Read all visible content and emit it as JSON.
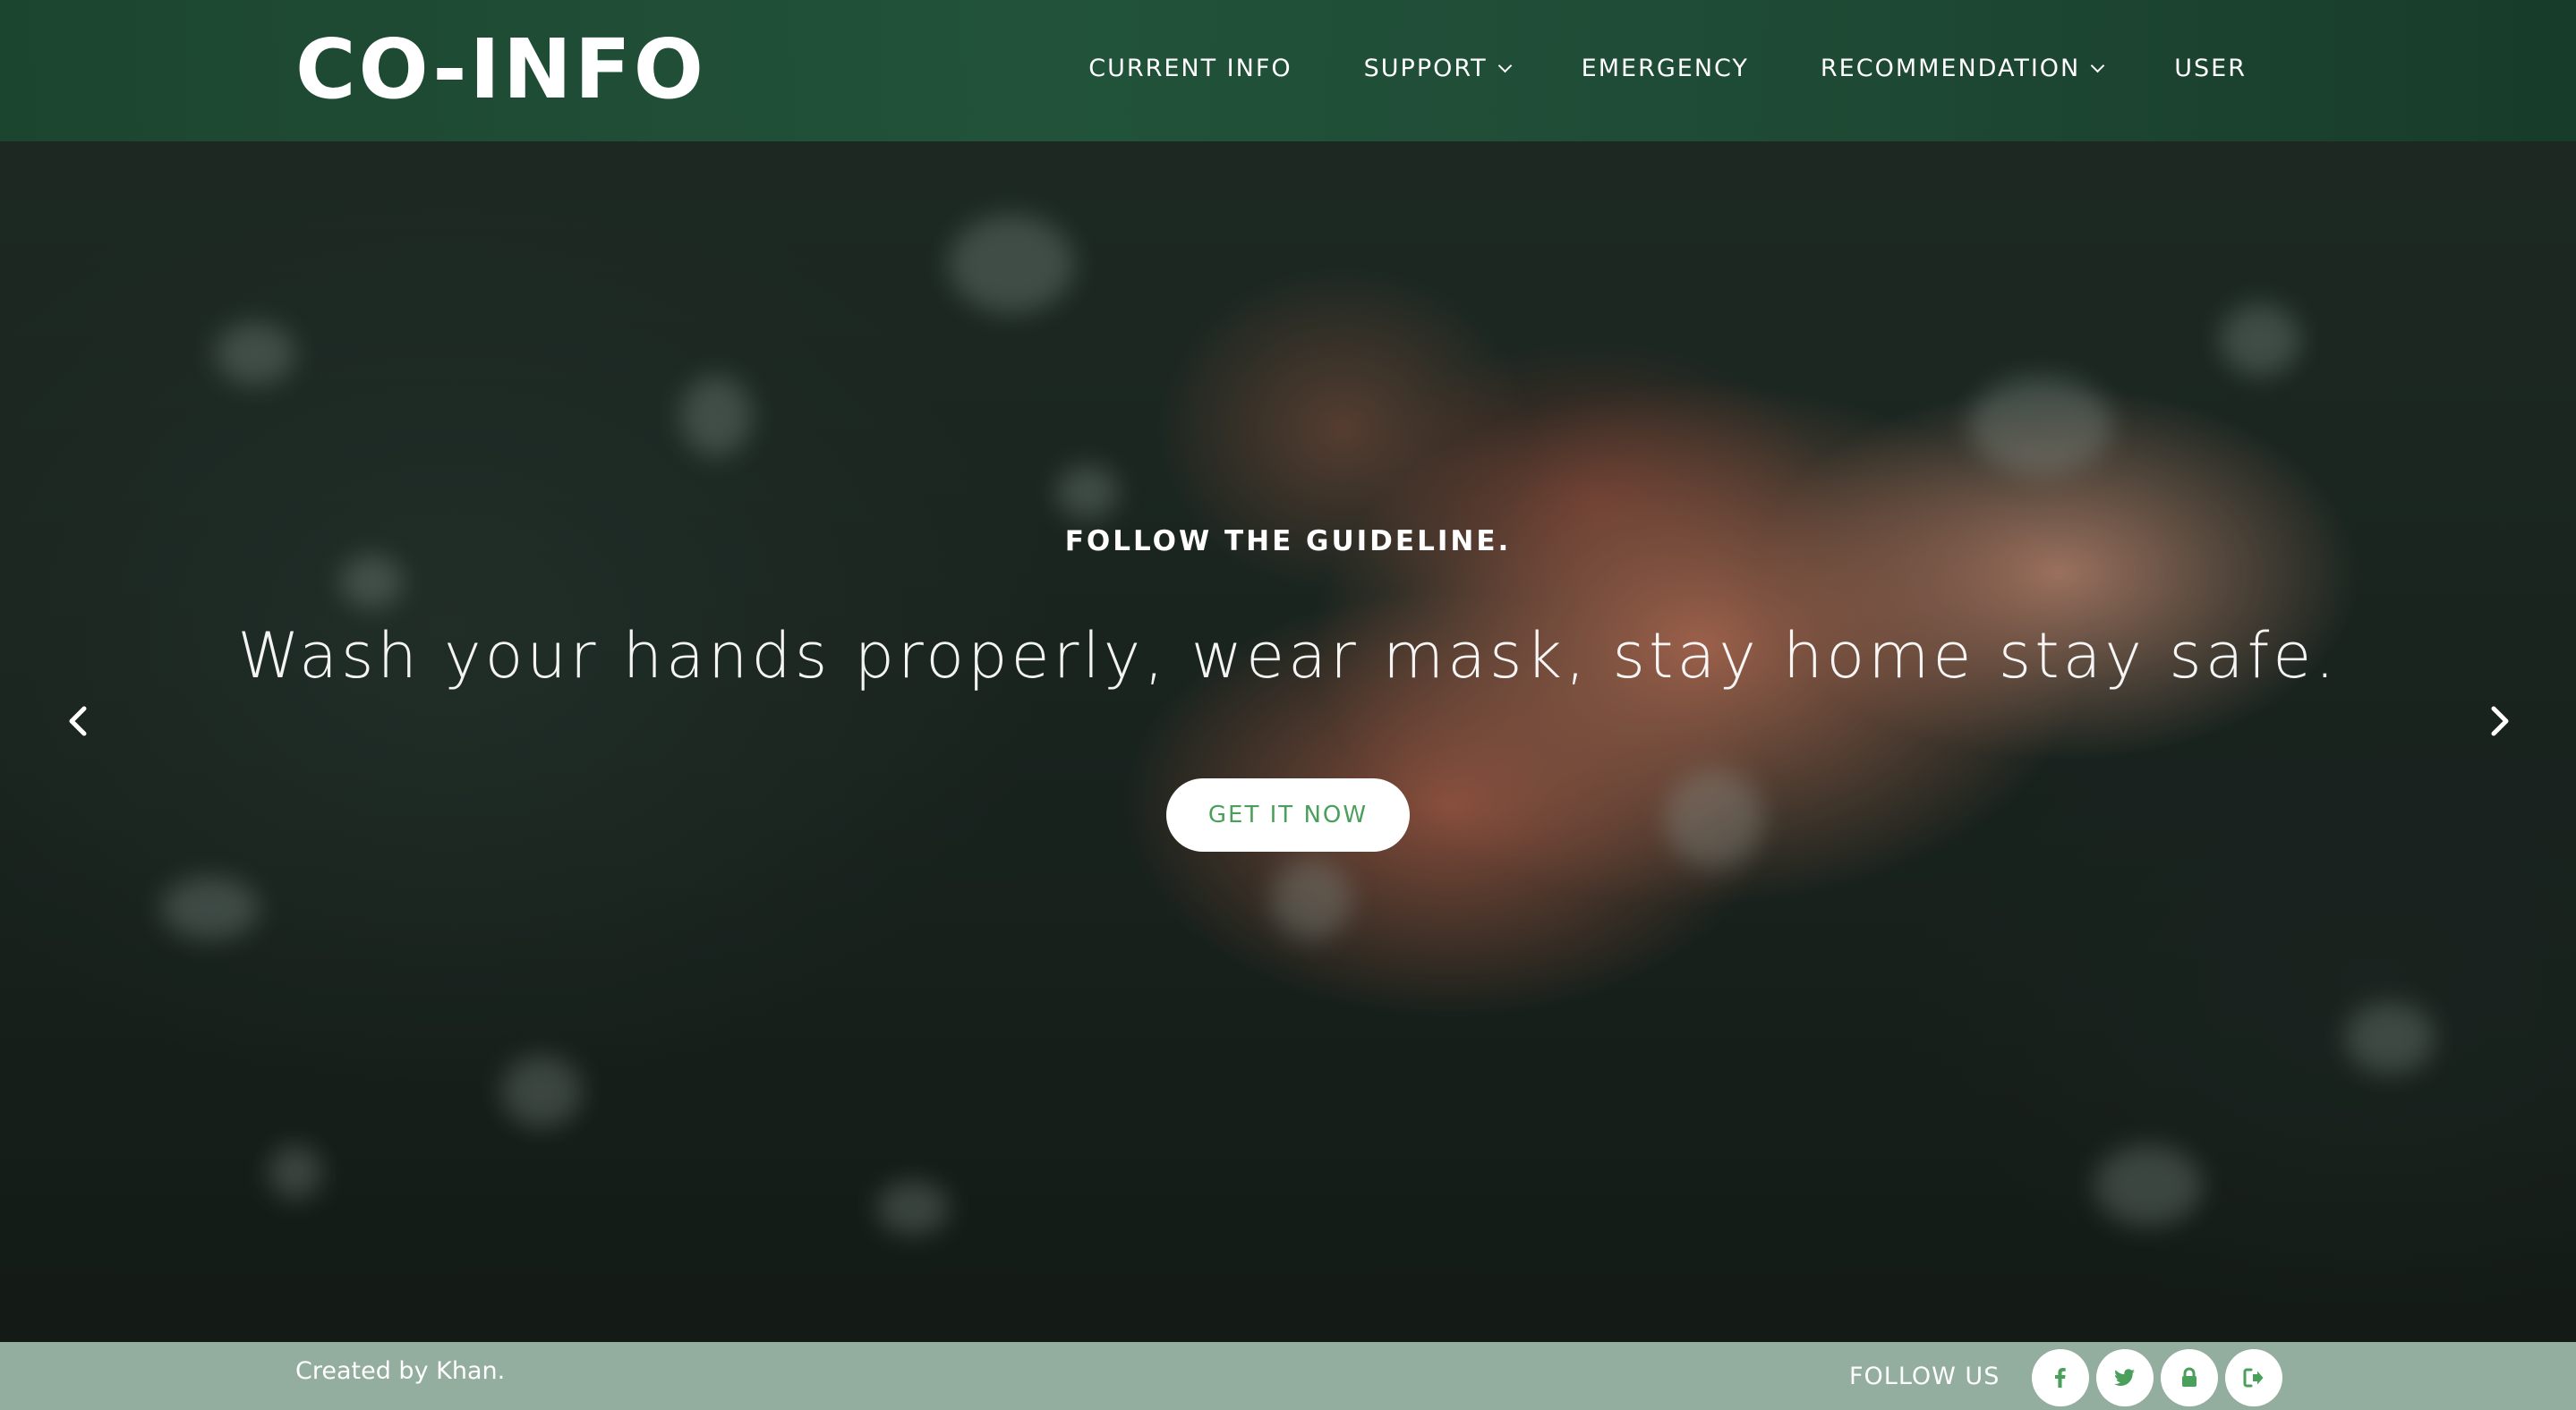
{
  "header": {
    "logo": "CO-INFO",
    "nav": [
      {
        "label": "CURRENT INFO",
        "has_dropdown": false
      },
      {
        "label": "SUPPORT",
        "has_dropdown": true
      },
      {
        "label": "EMERGENCY",
        "has_dropdown": false
      },
      {
        "label": "RECOMMENDATION",
        "has_dropdown": true
      },
      {
        "label": "USER",
        "has_dropdown": false
      }
    ]
  },
  "hero": {
    "kicker": "FOLLOW THE GUIDELINE.",
    "headline": "Wash your hands properly, wear mask, stay home stay safe.",
    "cta_label": "GET IT NOW",
    "prev_icon": "chevron-left-icon",
    "next_icon": "chevron-right-icon"
  },
  "footer": {
    "credit": "Created by Khan.",
    "follow_label": "FOLLOW US",
    "socials": [
      {
        "name": "facebook-icon"
      },
      {
        "name": "twitter-icon"
      },
      {
        "name": "lock-icon"
      },
      {
        "name": "sign-out-icon"
      }
    ]
  },
  "colors": {
    "header_bg": "#22563c",
    "footer_bg": "#93ad9e",
    "accent_green": "#4a9f5a",
    "text_light": "#ffffff"
  }
}
